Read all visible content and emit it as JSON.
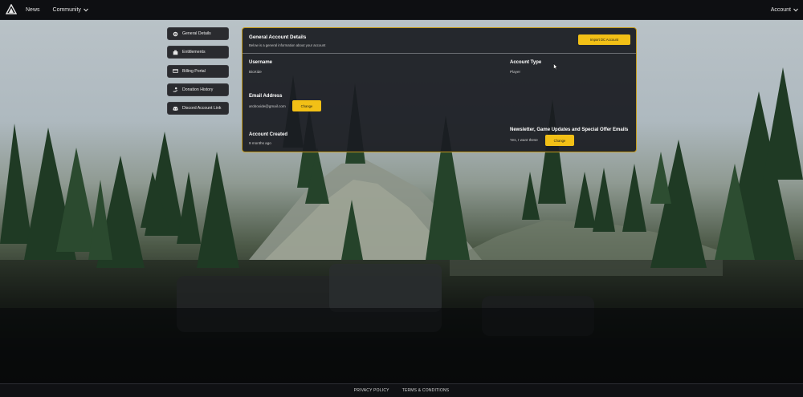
{
  "topnav": {
    "news": "News",
    "community": "Community",
    "account": "Account"
  },
  "sidebar": {
    "items": [
      {
        "label": "General Details",
        "icon": "gear-icon"
      },
      {
        "label": "Entitlements",
        "icon": "box-icon"
      },
      {
        "label": "Billing Portal",
        "icon": "credit-card-icon"
      },
      {
        "label": "Donation History",
        "icon": "hand-icon"
      },
      {
        "label": "Discord Account Link",
        "icon": "discord-icon"
      }
    ]
  },
  "panel": {
    "title": "General Account Details",
    "subtitle": "Below is a general information about your account",
    "import_button": "Import DC Account",
    "username_label": "Username",
    "username_value": "BioXide",
    "account_type_label": "Account Type",
    "account_type_value": "Player",
    "email_label": "Email Address",
    "email_value": "aroboxide@gmail.com",
    "email_change": "Change",
    "created_label": "Account Created",
    "created_value": "9 months ago",
    "newsletter_label": "Newsletter, Game Updates and Special Offer Emails",
    "newsletter_value": "Yes, I want these",
    "newsletter_change": "Change"
  },
  "footer": {
    "privacy": "PRIVACY POLICY",
    "terms": "TERMS & CONDITIONS"
  },
  "colors": {
    "accent": "#f2c016",
    "panel_border": "#c49a1a",
    "close_tab": "#e0393e"
  }
}
